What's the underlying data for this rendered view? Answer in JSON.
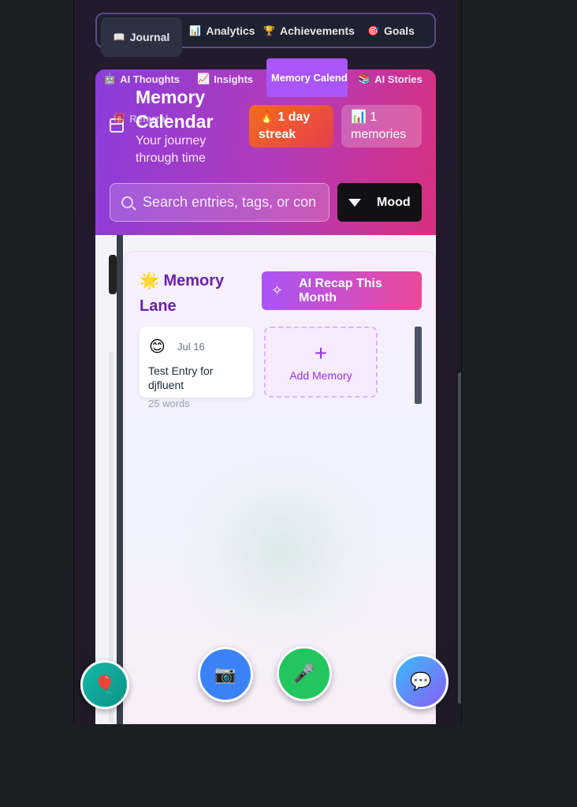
{
  "main_tabs": [
    {
      "icon": "📖",
      "label": "Journal"
    },
    {
      "icon": "📊",
      "label": "Analytics"
    },
    {
      "icon": "🏆",
      "label": "Achievements"
    },
    {
      "icon": "🎯",
      "label": "Goals"
    }
  ],
  "sub_tabs": [
    {
      "icon": "🤖",
      "label": "AI Thoughts"
    },
    {
      "icon": "📈",
      "label": "Insights"
    },
    {
      "icon": "🗓️",
      "label": "Memory Calendar"
    },
    {
      "icon": "📚",
      "label": "AI Stories"
    },
    {
      "icon": "🎁",
      "label": "Referral"
    }
  ],
  "header": {
    "title": "Memory Calendar",
    "subtitle": "Your journey through time",
    "streak_badge": "🔥 1 day streak",
    "memories_badge": "📊 1 memories",
    "search_placeholder": "Search entries, tags, or content...",
    "mood_button": "Mood"
  },
  "memory_lane": {
    "title": "🌟 Memory Lane",
    "recap_button": "AI Recap This Month",
    "entries": [
      {
        "emoji": "😊",
        "date": "Jul 16",
        "title": "Test Entry for djfluent",
        "words": "25 words"
      }
    ],
    "add_label": "Add Memory"
  },
  "fabs": {
    "balloon": "🎈",
    "camera": "📷",
    "mic": "🎤",
    "chat": "💬"
  }
}
